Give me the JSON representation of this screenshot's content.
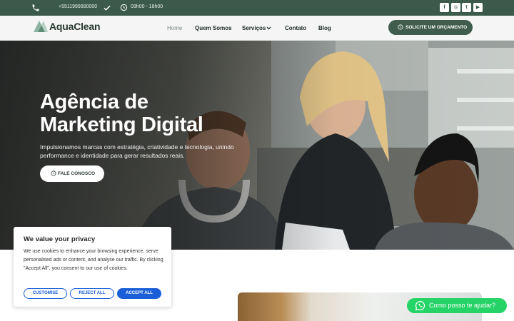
{
  "topbar": {
    "phone": "+5511999990000",
    "hours": "09h00 - 18h00",
    "icons": [
      "phone-icon",
      "check-icon",
      "clock-icon"
    ],
    "social": [
      {
        "name": "facebook",
        "glyph": "f"
      },
      {
        "name": "instagram",
        "glyph": "◎"
      },
      {
        "name": "twitter",
        "glyph": "t"
      },
      {
        "name": "youtube",
        "glyph": "▶"
      }
    ]
  },
  "header": {
    "logo_text": "AquaClean",
    "nav": [
      {
        "label": "Home",
        "active": true
      },
      {
        "label": "Quem Somos",
        "active": false
      },
      {
        "label": "Serviços",
        "active": false,
        "has_dropdown": true
      },
      {
        "label": "Contato",
        "active": false
      },
      {
        "label": "Blog",
        "active": false
      }
    ],
    "cta_label": "SOLICITE UM ORÇAMENTO"
  },
  "hero": {
    "title_line1": "Agência de",
    "title_line2": "Marketing Digital",
    "subtitle": "Impulsionamos marcas com estratégia, criatividade e tecnologia, unindo performance e identidade para gerar resultados reais.",
    "button_label": "FALE CONOSCO"
  },
  "cookie": {
    "title": "We value your privacy",
    "text": "We use cookies to enhance your browsing experience, serve personalised ads or content, and analyse our traffic. By clicking \"Accept All\", you consent to our use of cookies.",
    "customise_label": "CUSTOMISE",
    "reject_label": "REJECT ALL",
    "accept_label": "ACCEPT ALL"
  },
  "whatsapp": {
    "label": "Como posso te ajudar?"
  },
  "colors": {
    "brand_green": "#3c5a4b",
    "cookie_blue": "#1a5fd8",
    "whatsapp_green": "#25d366"
  }
}
